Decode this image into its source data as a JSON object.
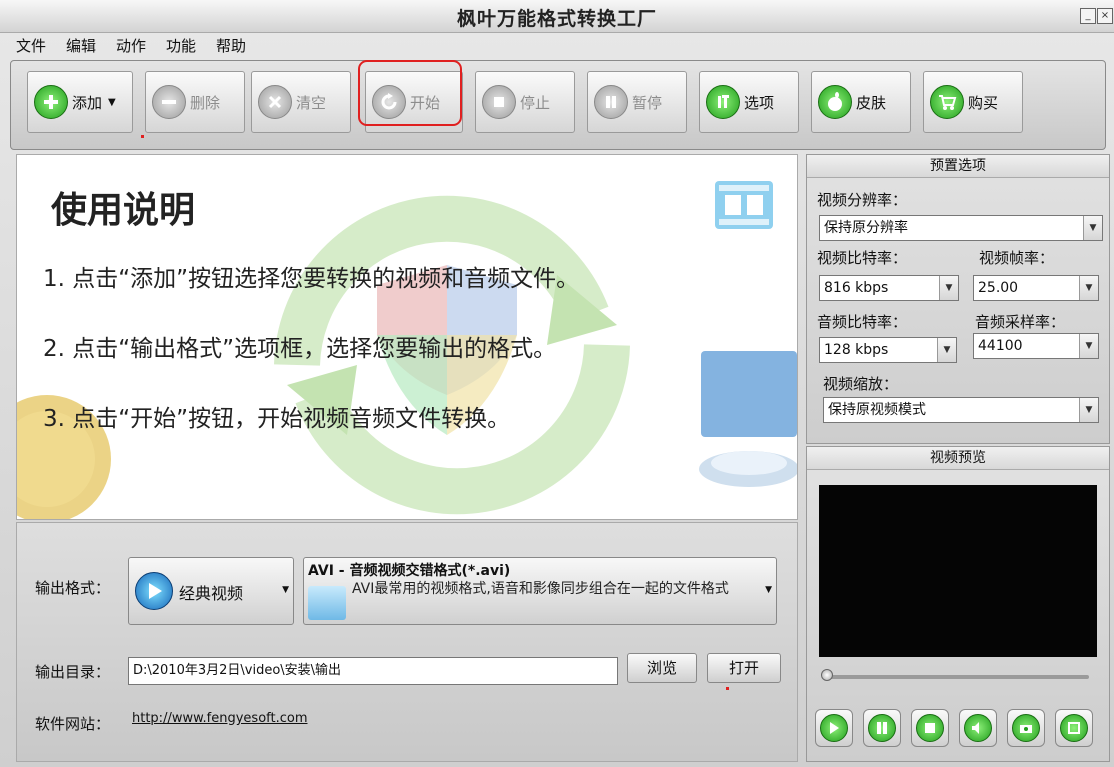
{
  "window": {
    "title": "枫叶万能格式转换工厂"
  },
  "menu": [
    "文件",
    "编辑",
    "动作",
    "功能",
    "帮助"
  ],
  "toolbar": {
    "add": "添加",
    "delete": "删除",
    "clear": "清空",
    "start": "开始",
    "stop": "停止",
    "pause": "暂停",
    "options": "选项",
    "skin": "皮肤",
    "buy": "购买"
  },
  "help": {
    "title": "使用说明",
    "steps": [
      "1. 点击“添加”按钮选择您要转换的视频和音频文件。",
      "2. 点击“输出格式”选项框，选择您要输出的格式。",
      "3. 点击“开始”按钮，开始视频音频文件转换。"
    ]
  },
  "output": {
    "format_label": "输出格式：",
    "category": "经典视频",
    "format_title": "AVI - 音频视频交错格式(*.avi)",
    "format_desc": "AVI最常用的视频格式,语音和影像同步组合在一起的文件格式",
    "dir_label": "输出目录：",
    "dir_value": "D:\\2010年3月2日\\video\\安装\\输出",
    "browse": "浏览",
    "open": "打开",
    "site_label": "软件网站：",
    "site_url": "http://www.fengyesoft.com"
  },
  "preset": {
    "header": "预置选项",
    "resolution_label": "视频分辨率：",
    "resolution": "保持原分辨率",
    "vbitrate_label": "视频比特率：",
    "vbitrate": "816 kbps",
    "framerate_label": "视频帧率：",
    "framerate": "25.00",
    "abitrate_label": "音频比特率：",
    "abitrate": "128 kbps",
    "samplerate_label": "音频采样率：",
    "samplerate": "44100",
    "scale_label": "视频缩放：",
    "scale": "保持原视频模式"
  },
  "preview": {
    "header": "视频预览"
  },
  "colors": {
    "accent_green": "#1f9d1a",
    "highlight_red": "#e02020"
  }
}
